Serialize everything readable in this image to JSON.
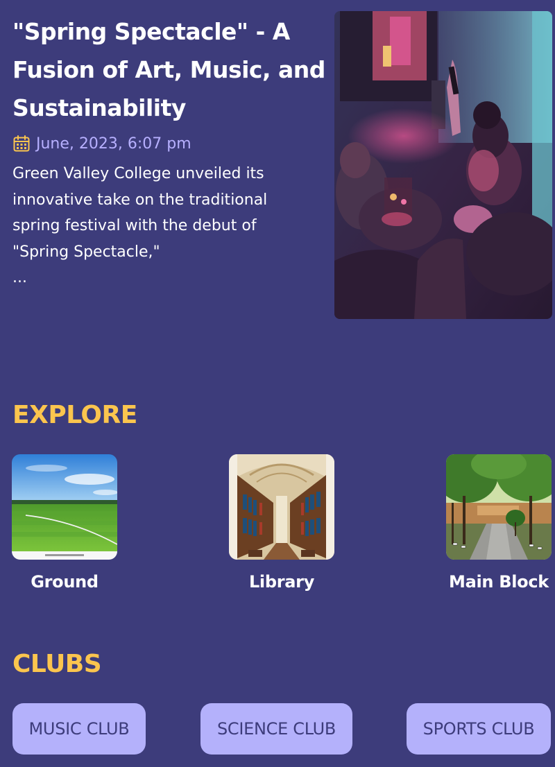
{
  "news": {
    "title": "\"Spring Spectacle\" - A Fusion of Art, Music, and Sustainability",
    "date": "June, 2023, 6:07 pm",
    "excerpt": "Green Valley College unveiled its innovative take on the traditional spring festival with the debut of \"Spring Spectacle,\"",
    "ellipsis": "...",
    "image_icon": "concert-crowd-photo"
  },
  "explore": {
    "heading": "EXPLORE",
    "places": [
      {
        "label": "Ground",
        "icon": "sports-field-photo"
      },
      {
        "label": "Library",
        "icon": "library-hall-photo"
      },
      {
        "label": "Main Block",
        "icon": "campus-walkway-photo"
      }
    ]
  },
  "clubs": {
    "heading": "CLUBS",
    "items": [
      {
        "label": "MUSIC CLUB"
      },
      {
        "label": "SCIENCE CLUB"
      },
      {
        "label": "SPORTS CLUB"
      }
    ]
  },
  "colors": {
    "background": "#3d3c7b",
    "accent_heading": "#fbc54e",
    "date_text": "#b7b0ff",
    "club_button": "#b4b1fb"
  }
}
